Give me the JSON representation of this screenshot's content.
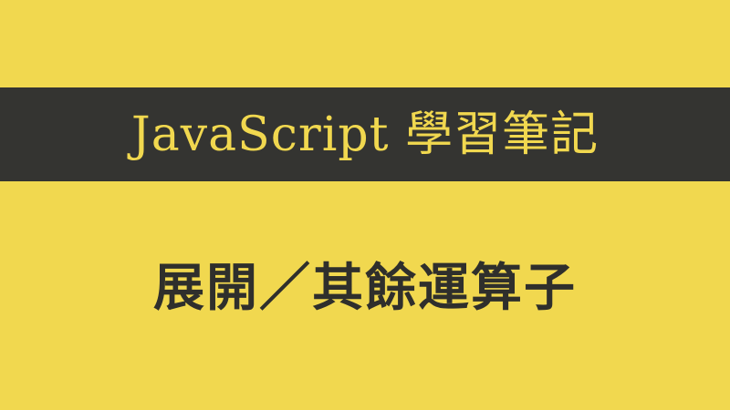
{
  "banner": {
    "title": "JavaScript 學習筆記"
  },
  "subtitle": "展開／其餘運算子",
  "colors": {
    "background": "#f1d84f",
    "banner": "#343431",
    "title_text": "#f1d84f",
    "subtitle_text": "#2f2f2c"
  }
}
